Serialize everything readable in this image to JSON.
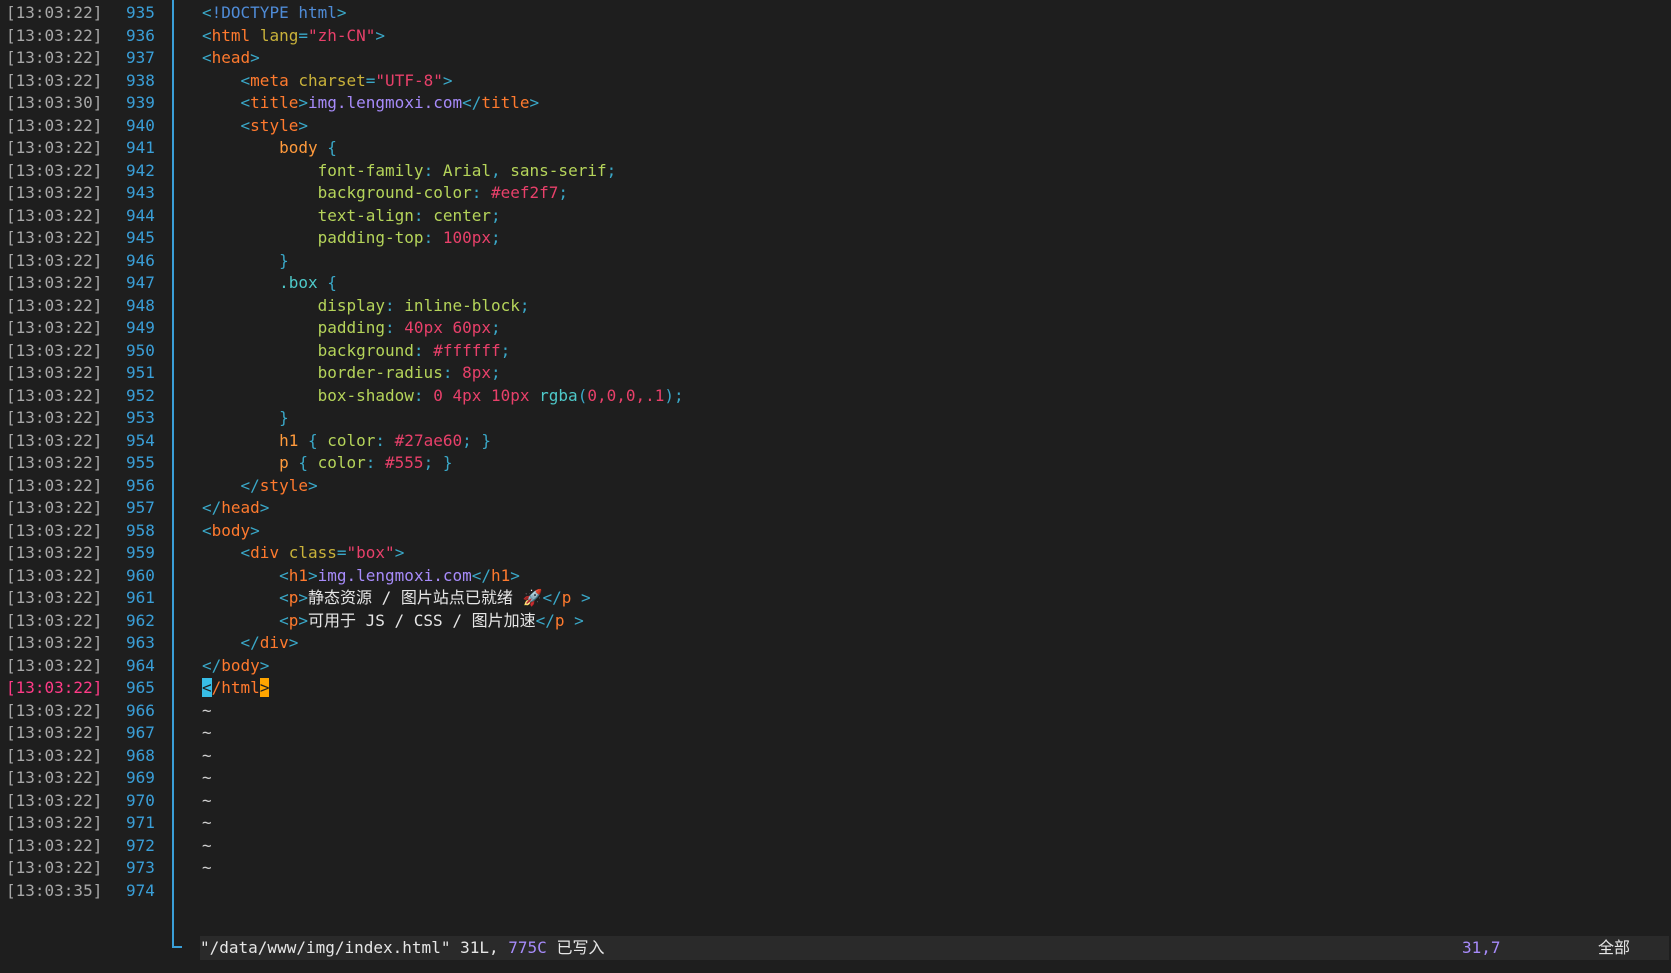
{
  "lines": [
    {
      "ts": "[13:03:22]",
      "num": "935"
    },
    {
      "ts": "[13:03:22]",
      "num": "936"
    },
    {
      "ts": "[13:03:22]",
      "num": "937"
    },
    {
      "ts": "[13:03:22]",
      "num": "938"
    },
    {
      "ts": "[13:03:30]",
      "num": "939"
    },
    {
      "ts": "[13:03:22]",
      "num": "940"
    },
    {
      "ts": "[13:03:22]",
      "num": "941"
    },
    {
      "ts": "[13:03:22]",
      "num": "942"
    },
    {
      "ts": "[13:03:22]",
      "num": "943"
    },
    {
      "ts": "[13:03:22]",
      "num": "944"
    },
    {
      "ts": "[13:03:22]",
      "num": "945"
    },
    {
      "ts": "[13:03:22]",
      "num": "946"
    },
    {
      "ts": "[13:03:22]",
      "num": "947"
    },
    {
      "ts": "[13:03:22]",
      "num": "948"
    },
    {
      "ts": "[13:03:22]",
      "num": "949"
    },
    {
      "ts": "[13:03:22]",
      "num": "950"
    },
    {
      "ts": "[13:03:22]",
      "num": "951"
    },
    {
      "ts": "[13:03:22]",
      "num": "952"
    },
    {
      "ts": "[13:03:22]",
      "num": "953"
    },
    {
      "ts": "[13:03:22]",
      "num": "954"
    },
    {
      "ts": "[13:03:22]",
      "num": "955"
    },
    {
      "ts": "[13:03:22]",
      "num": "956"
    },
    {
      "ts": "[13:03:22]",
      "num": "957"
    },
    {
      "ts": "[13:03:22]",
      "num": "958"
    },
    {
      "ts": "[13:03:22]",
      "num": "959"
    },
    {
      "ts": "[13:03:22]",
      "num": "960"
    },
    {
      "ts": "[13:03:22]",
      "num": "961"
    },
    {
      "ts": "[13:03:22]",
      "num": "962"
    },
    {
      "ts": "[13:03:22]",
      "num": "963"
    },
    {
      "ts": "[13:03:22]",
      "num": "964"
    },
    {
      "ts": "[13:03:22]",
      "num": "965",
      "active": true
    },
    {
      "ts": "[13:03:22]",
      "num": "966"
    },
    {
      "ts": "[13:03:22]",
      "num": "967"
    },
    {
      "ts": "[13:03:22]",
      "num": "968"
    },
    {
      "ts": "[13:03:22]",
      "num": "969"
    },
    {
      "ts": "[13:03:22]",
      "num": "970"
    },
    {
      "ts": "[13:03:22]",
      "num": "971"
    },
    {
      "ts": "[13:03:22]",
      "num": "972"
    },
    {
      "ts": "[13:03:22]",
      "num": "973"
    },
    {
      "ts": "[13:03:35]",
      "num": "974"
    }
  ],
  "code": [
    [
      [
        "c-br",
        "<"
      ],
      [
        "c-doc",
        "!DOCTYPE html"
      ],
      [
        "c-br",
        ">"
      ]
    ],
    [
      [
        "c-br",
        "<"
      ],
      [
        "c-tag",
        "html "
      ],
      [
        "c-attr",
        "lang"
      ],
      [
        "c-br",
        "="
      ],
      [
        "c-str",
        "\"zh-CN\""
      ],
      [
        "c-br",
        ">"
      ]
    ],
    [
      [
        "c-br",
        "<"
      ],
      [
        "c-tag",
        "head"
      ],
      [
        "c-br",
        ">"
      ]
    ],
    [
      [
        "c-txt",
        "    "
      ],
      [
        "c-br",
        "<"
      ],
      [
        "c-tag",
        "meta "
      ],
      [
        "c-attr",
        "charset"
      ],
      [
        "c-br",
        "="
      ],
      [
        "c-str",
        "\"UTF-8\""
      ],
      [
        "c-br",
        ">"
      ]
    ],
    [
      [
        "c-txt",
        "    "
      ],
      [
        "c-br",
        "<"
      ],
      [
        "c-tag",
        "title"
      ],
      [
        "c-br",
        ">"
      ],
      [
        "c-title",
        "img.lengmoxi.com"
      ],
      [
        "c-br",
        "</"
      ],
      [
        "c-tag",
        "title"
      ],
      [
        "c-br",
        ">"
      ]
    ],
    [
      [
        "c-txt",
        "    "
      ],
      [
        "c-br",
        "<"
      ],
      [
        "c-tag",
        "style"
      ],
      [
        "c-br",
        ">"
      ]
    ],
    [
      [
        "c-txt",
        "        "
      ],
      [
        "c-sel",
        "body "
      ],
      [
        "c-pun",
        "{"
      ]
    ],
    [
      [
        "c-txt",
        "            "
      ],
      [
        "c-prop",
        "font-family"
      ],
      [
        "c-pun",
        ": "
      ],
      [
        "c-val",
        "Arial"
      ],
      [
        "c-pun",
        ", "
      ],
      [
        "c-val",
        "sans-serif"
      ],
      [
        "c-pun",
        ";"
      ]
    ],
    [
      [
        "c-txt",
        "            "
      ],
      [
        "c-prop",
        "background-color"
      ],
      [
        "c-pun",
        ": "
      ],
      [
        "c-num",
        "#eef2f7"
      ],
      [
        "c-pun",
        ";"
      ]
    ],
    [
      [
        "c-txt",
        "            "
      ],
      [
        "c-prop",
        "text-align"
      ],
      [
        "c-pun",
        ": "
      ],
      [
        "c-val",
        "center"
      ],
      [
        "c-pun",
        ";"
      ]
    ],
    [
      [
        "c-txt",
        "            "
      ],
      [
        "c-prop",
        "padding-top"
      ],
      [
        "c-pun",
        ": "
      ],
      [
        "c-num",
        "100px"
      ],
      [
        "c-pun",
        ";"
      ]
    ],
    [
      [
        "c-txt",
        "        "
      ],
      [
        "c-pun",
        "}"
      ]
    ],
    [
      [
        "c-txt",
        "        "
      ],
      [
        "c-cls",
        ".box "
      ],
      [
        "c-pun",
        "{"
      ]
    ],
    [
      [
        "c-txt",
        "            "
      ],
      [
        "c-prop",
        "display"
      ],
      [
        "c-pun",
        ": "
      ],
      [
        "c-val",
        "inline-block"
      ],
      [
        "c-pun",
        ";"
      ]
    ],
    [
      [
        "c-txt",
        "            "
      ],
      [
        "c-prop",
        "padding"
      ],
      [
        "c-pun",
        ": "
      ],
      [
        "c-num",
        "40px 60px"
      ],
      [
        "c-pun",
        ";"
      ]
    ],
    [
      [
        "c-txt",
        "            "
      ],
      [
        "c-prop",
        "background"
      ],
      [
        "c-pun",
        ": "
      ],
      [
        "c-num",
        "#ffffff"
      ],
      [
        "c-pun",
        ";"
      ]
    ],
    [
      [
        "c-txt",
        "            "
      ],
      [
        "c-prop",
        "border-radius"
      ],
      [
        "c-pun",
        ": "
      ],
      [
        "c-num",
        "8px"
      ],
      [
        "c-pun",
        ";"
      ]
    ],
    [
      [
        "c-txt",
        "            "
      ],
      [
        "c-prop",
        "box-shadow"
      ],
      [
        "c-pun",
        ": "
      ],
      [
        "c-num",
        "0 4px 10px "
      ],
      [
        "c-fn",
        "rgba"
      ],
      [
        "c-pun",
        "("
      ],
      [
        "c-num",
        "0,0,0,.1"
      ],
      [
        "c-pun",
        ");"
      ]
    ],
    [
      [
        "c-txt",
        "        "
      ],
      [
        "c-pun",
        "}"
      ]
    ],
    [
      [
        "c-txt",
        "        "
      ],
      [
        "c-sel",
        "h1 "
      ],
      [
        "c-pun",
        "{ "
      ],
      [
        "c-prop",
        "color"
      ],
      [
        "c-pun",
        ": "
      ],
      [
        "c-num",
        "#27ae60"
      ],
      [
        "c-pun",
        "; }"
      ]
    ],
    [
      [
        "c-txt",
        "        "
      ],
      [
        "c-sel",
        "p "
      ],
      [
        "c-pun",
        "{ "
      ],
      [
        "c-prop",
        "color"
      ],
      [
        "c-pun",
        ": "
      ],
      [
        "c-num",
        "#555"
      ],
      [
        "c-pun",
        "; }"
      ]
    ],
    [
      [
        "c-txt",
        "    "
      ],
      [
        "c-br",
        "</"
      ],
      [
        "c-tag",
        "style"
      ],
      [
        "c-br",
        ">"
      ]
    ],
    [
      [
        "c-br",
        "</"
      ],
      [
        "c-tag",
        "head"
      ],
      [
        "c-br",
        ">"
      ]
    ],
    [
      [
        "c-br",
        "<"
      ],
      [
        "c-tag",
        "body"
      ],
      [
        "c-br",
        ">"
      ]
    ],
    [
      [
        "c-txt",
        "    "
      ],
      [
        "c-br",
        "<"
      ],
      [
        "c-tag",
        "div "
      ],
      [
        "c-attr",
        "class"
      ],
      [
        "c-br",
        "="
      ],
      [
        "c-str",
        "\"box\""
      ],
      [
        "c-br",
        ">"
      ]
    ],
    [
      [
        "c-txt",
        "        "
      ],
      [
        "c-br",
        "<"
      ],
      [
        "c-tag",
        "h1"
      ],
      [
        "c-br",
        ">"
      ],
      [
        "c-title",
        "img.lengmoxi.com"
      ],
      [
        "c-br",
        "</"
      ],
      [
        "c-tag",
        "h1"
      ],
      [
        "c-br",
        ">"
      ]
    ],
    [
      [
        "c-txt",
        "        "
      ],
      [
        "c-br",
        "<"
      ],
      [
        "c-tag",
        "p"
      ],
      [
        "c-br",
        ">"
      ],
      [
        "c-txt",
        "静态资源 / 图片站点已就绪 🚀"
      ],
      [
        "c-br",
        "</"
      ],
      [
        "c-tag",
        "p"
      ],
      [
        "c-br",
        " >"
      ]
    ],
    [
      [
        "c-txt",
        "        "
      ],
      [
        "c-br",
        "<"
      ],
      [
        "c-tag",
        "p"
      ],
      [
        "c-br",
        ">"
      ],
      [
        "c-txt",
        "可用于 JS / CSS / 图片加速"
      ],
      [
        "c-br",
        "</"
      ],
      [
        "c-tag",
        "p"
      ],
      [
        "c-br",
        " >"
      ]
    ],
    [
      [
        "c-txt",
        "    "
      ],
      [
        "c-br",
        "</"
      ],
      [
        "c-tag",
        "div"
      ],
      [
        "c-br",
        ">"
      ]
    ],
    [
      [
        "c-br",
        "</"
      ],
      [
        "c-tag",
        "body"
      ],
      [
        "c-br",
        ">"
      ]
    ],
    [
      [
        "cur-l",
        "<"
      ],
      [
        "c-tag",
        "/html"
      ],
      [
        "cur-r",
        ">"
      ]
    ],
    [
      [
        "tilde",
        "~"
      ]
    ],
    [
      [
        "tilde",
        "~"
      ]
    ],
    [
      [
        "tilde",
        "~"
      ]
    ],
    [
      [
        "tilde",
        "~"
      ]
    ],
    [
      [
        "tilde",
        "~"
      ]
    ],
    [
      [
        "tilde",
        "~"
      ]
    ],
    [
      [
        "tilde",
        "~"
      ]
    ],
    [
      [
        "tilde",
        "~"
      ]
    ]
  ],
  "status": {
    "file": "\"/data/www/img/index.html\"",
    "lines": "31L,",
    "chars": "775C",
    "written": "已写入",
    "position": "31,7",
    "percent": "全部"
  }
}
